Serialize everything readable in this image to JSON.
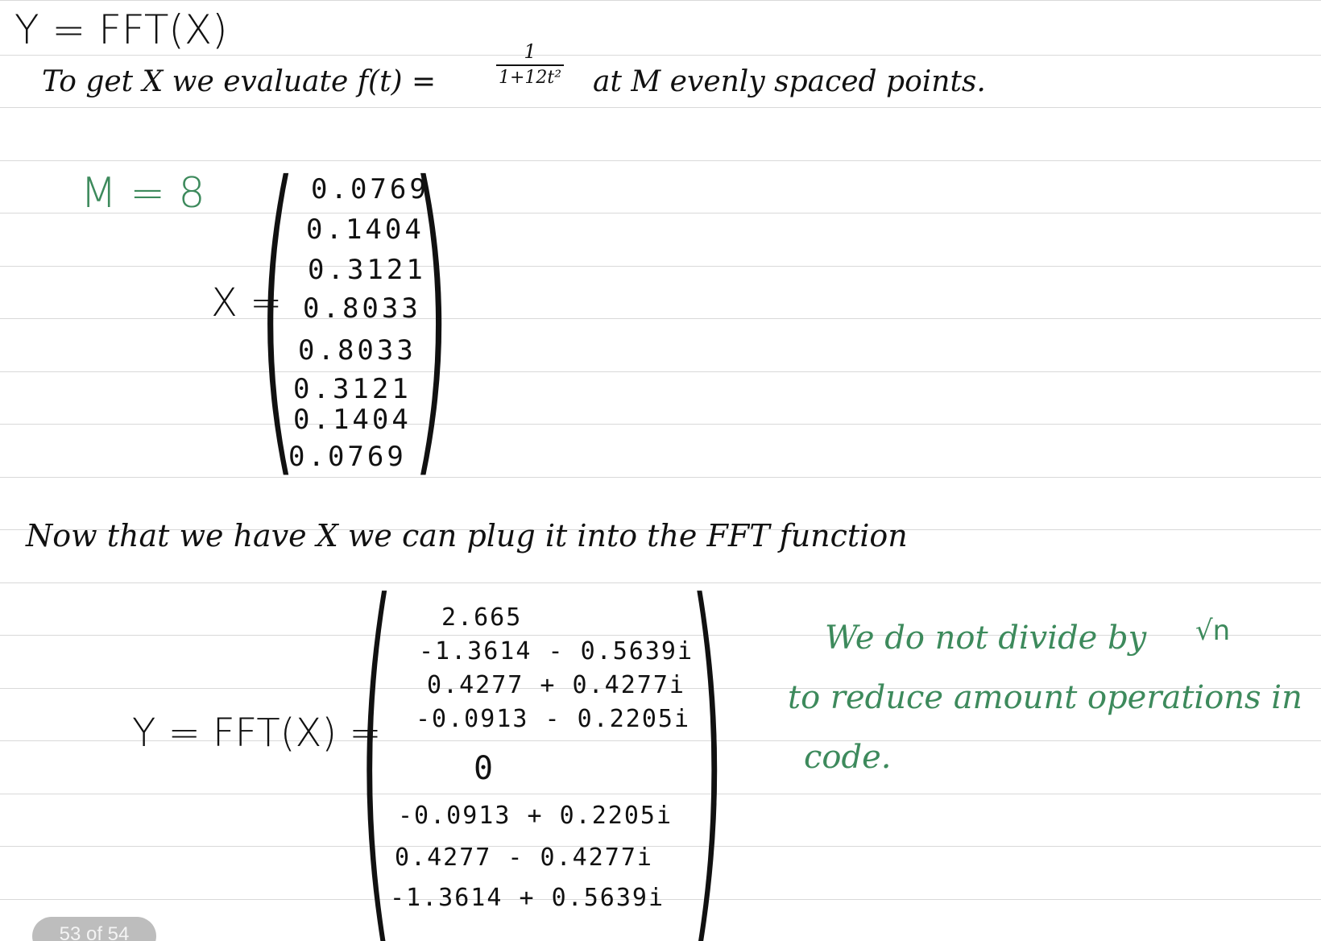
{
  "header": {
    "title": "Y = FFT(X)"
  },
  "intro": {
    "prefix": "To get X we evaluate f(t) =",
    "fraction_numerator": "1",
    "fraction_denominator": "1+12t²",
    "suffix": "at M evenly spaced points."
  },
  "m_label": "M = 8",
  "x_vector": {
    "label": "X =",
    "values": [
      "0.0769",
      "0.1404",
      "0.3121",
      "0.8033",
      "0.8033",
      "0.3121",
      "0.1404",
      "0.0769"
    ]
  },
  "transition_text": "Now that we have X we can plug it into the FFT function",
  "y_vector": {
    "label": "Y = FFT(X) =",
    "values": [
      "2.665",
      "-1.3614 - 0.5639i",
      "0.4277 + 0.4277i",
      "-0.0913 - 0.2205i",
      "0",
      "-0.0913 + 0.2205i",
      "0.4277 - 0.4277i",
      "-1.3614 + 0.5639i"
    ]
  },
  "note": {
    "line1": "We do not divide by",
    "line1_symbol": "√n",
    "line2": "to reduce amount operations in",
    "line3": "code."
  },
  "page_indicator": "53 of 54",
  "colors": {
    "ink": "#111111",
    "green_ink": "#3d8a5c",
    "rule": "#d9d9d9",
    "badge": "#bdbdbd"
  }
}
